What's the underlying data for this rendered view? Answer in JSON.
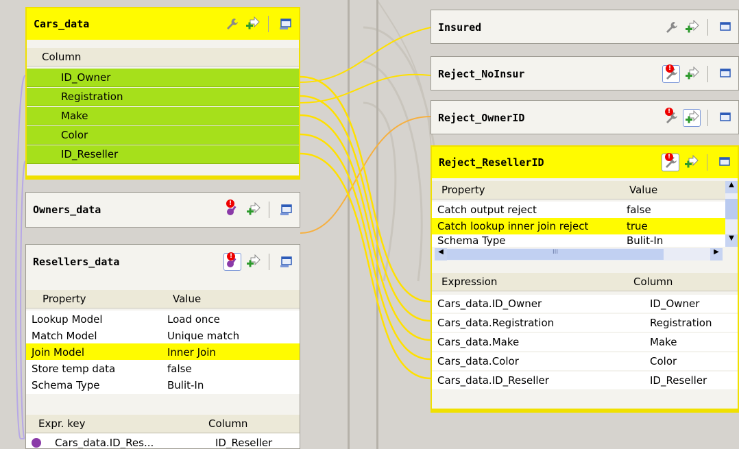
{
  "left": {
    "cars_data": {
      "title": "Cars_data",
      "column_header": "Column",
      "columns": [
        "ID_Owner",
        "Registration",
        "Make",
        "Color",
        "ID_Reseller"
      ]
    },
    "owners_data": {
      "title": "Owners_data"
    },
    "resellers_data": {
      "title": "Resellers_data",
      "property_header": "Property",
      "value_header": "Value",
      "props": [
        {
          "property": "Lookup Model",
          "value": "Load once"
        },
        {
          "property": "Match Model",
          "value": "Unique match"
        },
        {
          "property": "Join Model",
          "value": "Inner Join"
        },
        {
          "property": "Store temp data",
          "value": "false"
        },
        {
          "property": "Schema Type",
          "value": "Bulit-In"
        }
      ],
      "expr_key_header": "Expr. key",
      "column_header": "Column",
      "expr_row": {
        "expr": "Cars_data.ID_Res...",
        "column": "ID_Reseller"
      }
    }
  },
  "right": {
    "insured": {
      "title": "Insured"
    },
    "reject_noinsur": {
      "title": "Reject_NoInsur"
    },
    "reject_ownerid": {
      "title": "Reject_OwnerID"
    },
    "reject_resellerid": {
      "title": "Reject_ResellerID",
      "property_header": "Property",
      "value_header": "Value",
      "props": [
        {
          "property": "Catch output reject",
          "value": "false"
        },
        {
          "property": "Catch lookup inner join reject",
          "value": "true"
        },
        {
          "property": "Schema Type",
          "value": "Bulit-In"
        }
      ],
      "scroll_mark": "III",
      "expression_header": "Expression",
      "column_header": "Column",
      "rows": [
        {
          "expr": "Cars_data.ID_Owner",
          "column": "ID_Owner"
        },
        {
          "expr": "Cars_data.Registration",
          "column": "Registration"
        },
        {
          "expr": "Cars_data.Make",
          "column": "Make"
        },
        {
          "expr": "Cars_data.Color",
          "column": "Color"
        },
        {
          "expr": "Cars_data.ID_Reseller",
          "column": "ID_Reseller"
        }
      ]
    }
  },
  "colors": {
    "selected_header": "#fffb00",
    "mapped_row": "#a6e01b",
    "link_yellow": "#ffe000",
    "link_orange": "#f6b040",
    "link_lilac": "#b7a8e6"
  },
  "icons": [
    "wrench-icon",
    "add-arrow-icon",
    "window-icon",
    "error-badge-icon",
    "key-icon"
  ]
}
